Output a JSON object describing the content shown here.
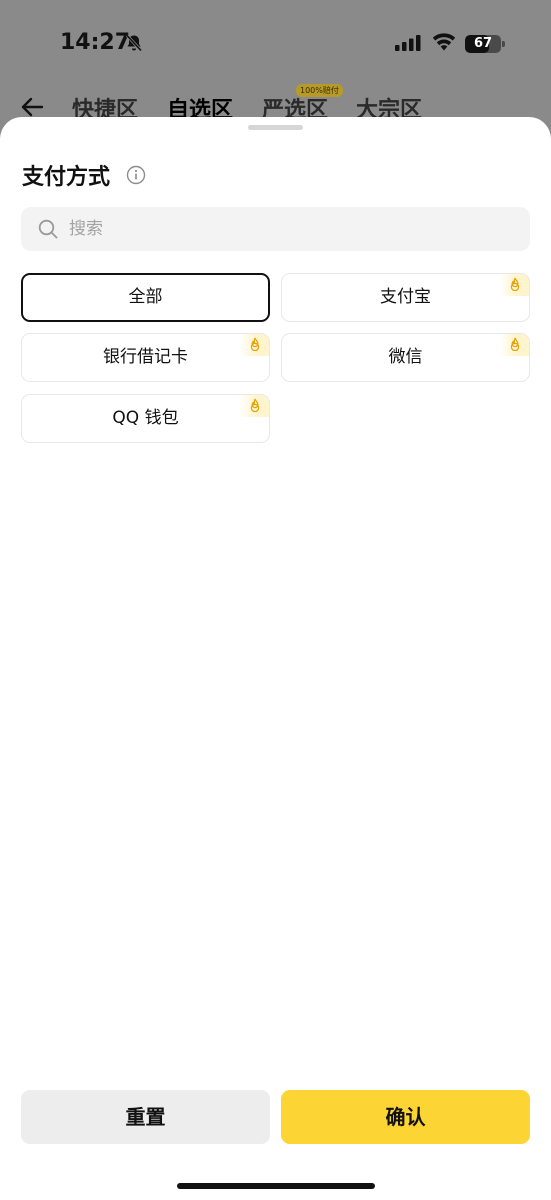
{
  "status_bar": {
    "time": "14:27",
    "battery": "67",
    "battery_level": 0.67,
    "icons": [
      "bell-slash-icon",
      "signal-icon",
      "wifi-icon",
      "battery-icon"
    ]
  },
  "nav": {
    "back_icon": "arrow-left-icon",
    "tabs": [
      {
        "label": "快捷区",
        "active": false
      },
      {
        "label": "自选区",
        "active": true
      },
      {
        "label": "严选区",
        "active": false
      },
      {
        "label": "大宗区",
        "active": false
      }
    ],
    "badge": "100%赔付"
  },
  "sheet": {
    "title": "支付方式",
    "info_icon": "info-circle-icon",
    "search": {
      "placeholder": "搜索",
      "value": ""
    },
    "options": [
      {
        "label": "全部",
        "selected": true,
        "hot": false
      },
      {
        "label": "支付宝",
        "selected": false,
        "hot": true
      },
      {
        "label": "银行借记卡",
        "selected": false,
        "hot": true
      },
      {
        "label": "微信",
        "selected": false,
        "hot": true
      },
      {
        "label": "QQ 钱包",
        "selected": false,
        "hot": true
      }
    ],
    "reset_label": "重置",
    "confirm_label": "确认",
    "colors": {
      "accent": "#fcd535",
      "secondary": "#ededed"
    }
  }
}
